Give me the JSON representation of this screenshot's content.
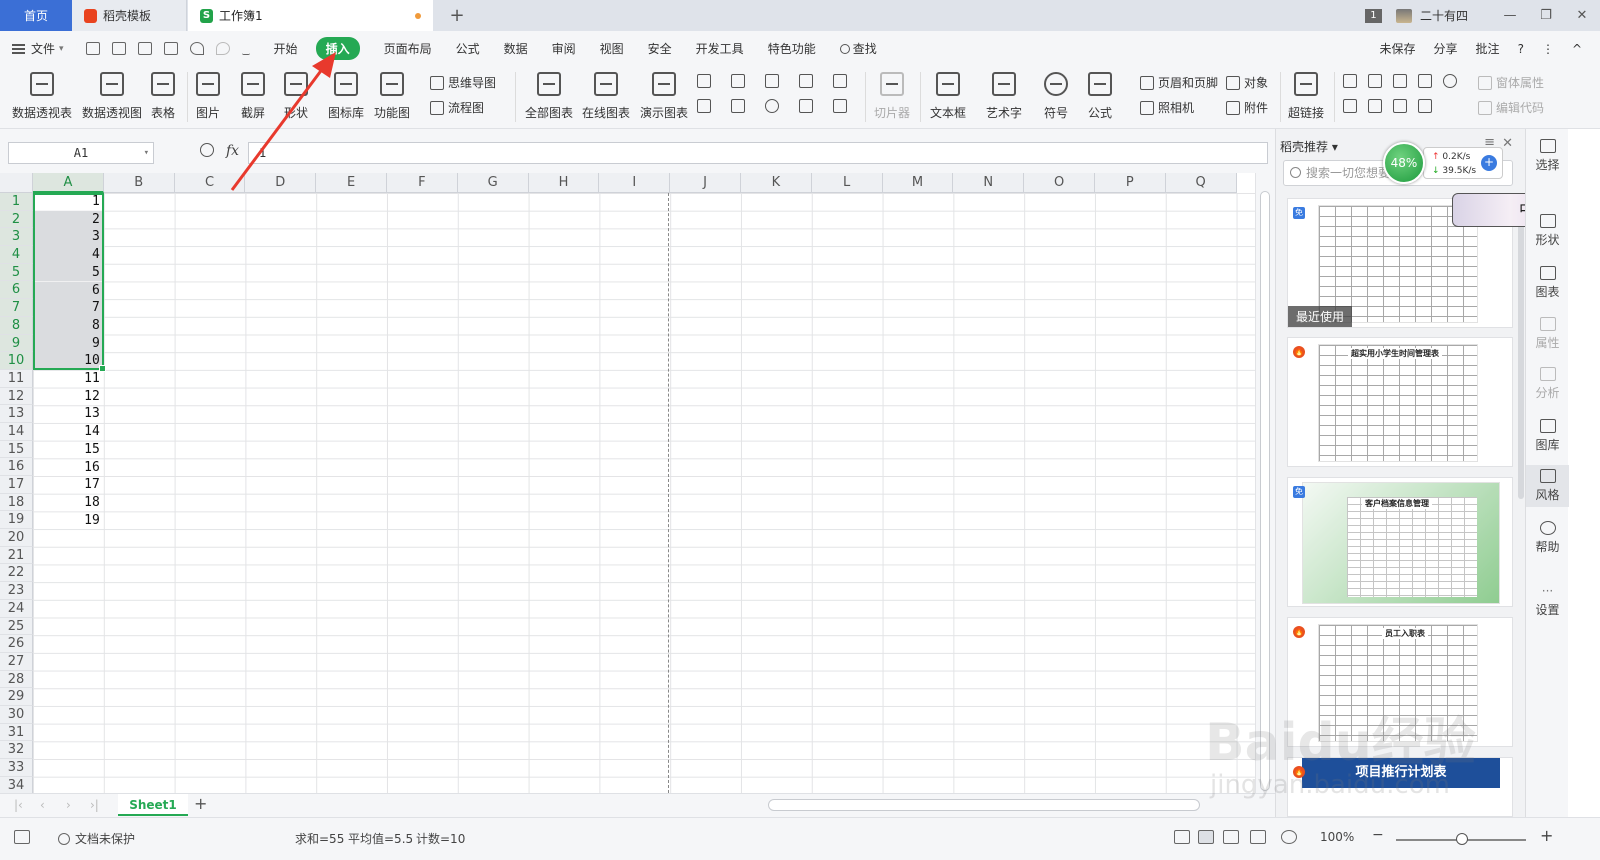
{
  "tabs": {
    "home": "首页",
    "template": "稻壳模板",
    "workbook": "工作簿1",
    "add": "+"
  },
  "window": {
    "count_badge": "1",
    "user_name": "二十有四",
    "minimize": "—",
    "restore": "❐",
    "close": "✕"
  },
  "menu": {
    "file": "文件",
    "file_caret": "▾",
    "tabs": [
      "开始",
      "插入",
      "页面布局",
      "公式",
      "数据",
      "审阅",
      "视图",
      "安全",
      "开发工具",
      "特色功能",
      "查找"
    ],
    "active_tab": "插入",
    "unsaved": "未保存",
    "share": "分享",
    "comment": "批注",
    "help": "?",
    "more": "⋮",
    "collapse": "^"
  },
  "ribbon": {
    "big": [
      "数据透视表",
      "数据透视图",
      "表格",
      "图片",
      "截屏",
      "形状",
      "图标库",
      "功能图",
      "全部图表",
      "在线图表",
      "演示图表",
      "切片器",
      "文本框",
      "艺术字",
      "符号",
      "公式",
      "超链接"
    ],
    "small": {
      "mindmap": "思维导图",
      "flowchart": "流程图",
      "header_footer": "页眉和页脚",
      "object": "对象",
      "camera": "照相机",
      "attachment": "附件",
      "window_props": "窗体属性",
      "edit_code": "编辑代码"
    }
  },
  "formula": {
    "name_box": "A1",
    "fx": "fx",
    "value": "1"
  },
  "grid": {
    "columns": [
      "A",
      "B",
      "C",
      "D",
      "E",
      "F",
      "G",
      "H",
      "I",
      "J",
      "K",
      "L",
      "M",
      "N",
      "O",
      "P",
      "Q"
    ],
    "rows": [
      "1",
      "2",
      "3",
      "4",
      "5",
      "6",
      "7",
      "8",
      "9",
      "10",
      "11",
      "12",
      "13",
      "14",
      "15",
      "16",
      "17",
      "18",
      "19",
      "20",
      "21",
      "22",
      "23",
      "24",
      "25",
      "26",
      "27",
      "28",
      "29",
      "30",
      "31",
      "32",
      "33",
      "34"
    ],
    "column_a_values": [
      "1",
      "2",
      "3",
      "4",
      "5",
      "6",
      "7",
      "8",
      "9",
      "10",
      "11",
      "12",
      "13",
      "14",
      "15",
      "16",
      "17",
      "18",
      "19"
    ],
    "selected_range": "A1:A10"
  },
  "sheets": {
    "tabs": [
      "Sheet1"
    ],
    "add": "+"
  },
  "status": {
    "protection": "文档未保护",
    "sum": "求和=55",
    "avg": "平均值=5.5",
    "count": "计数=10",
    "zoom": "100%",
    "zoom_out": "−",
    "zoom_in": "+"
  },
  "pane": {
    "title": "稻壳推荐",
    "search_placeholder": "搜索一切您想要",
    "recent_label": "最近使用",
    "cards": [
      {
        "badge": "免",
        "title": ""
      },
      {
        "badge": "🔥",
        "title": "超实用小学生时间管理表"
      },
      {
        "badge": "免",
        "title": "客户档案信息管理"
      },
      {
        "badge": "🔥",
        "title": "员工入职表"
      },
      {
        "badge": "🔥",
        "title": "项目推行计划表"
      }
    ]
  },
  "speed_widget": {
    "percent": "48%",
    "upload": "0.2K/s",
    "download": "39.5K/s",
    "ime_char": "中"
  },
  "sidebar": [
    "选择",
    "形状",
    "图表",
    "属性",
    "分析",
    "图库",
    "风格",
    "帮助",
    "设置"
  ],
  "watermark": {
    "logo": "Baidu经验",
    "url": "jingyan.baidu.com"
  },
  "colors": {
    "accent_green": "#25a954",
    "home_tab_blue": "#3b6fd6",
    "arrow_red": "#e8392d"
  }
}
